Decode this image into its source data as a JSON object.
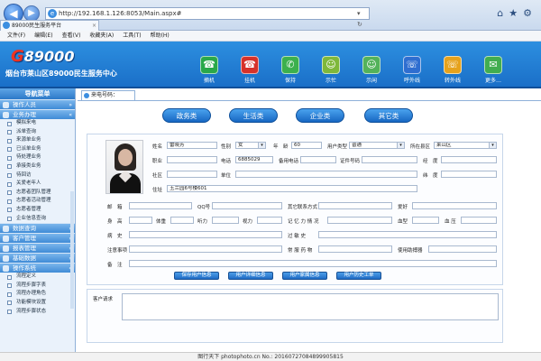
{
  "browser": {
    "url": "http://192.168.1.126:8053/Main.aspx#",
    "addr_ctrls": "▾ ↻ ✕",
    "tab_title": "89000民生服务平台",
    "tab_close": "×",
    "back": "◀",
    "forward": "▶"
  },
  "menubar": [
    "文件(F)",
    "编辑(E)",
    "查看(V)",
    "收藏夹(A)",
    "工具(T)",
    "帮助(H)"
  ],
  "header": {
    "logo": "89000",
    "logo_mark": "G",
    "title": "烟台市莱山区89000民生服务中心",
    "buttons": [
      {
        "label": "摘机",
        "color": "#2aa84a",
        "glyph": "☎"
      },
      {
        "label": "挂机",
        "color": "#d6322a",
        "glyph": "☎"
      },
      {
        "label": "保持",
        "color": "#3cb04d",
        "glyph": "✆"
      },
      {
        "label": "示忙",
        "color": "#7fb83a",
        "glyph": "☺"
      },
      {
        "label": "示闲",
        "color": "#53b25a",
        "glyph": "☺"
      },
      {
        "label": "呼外线",
        "color": "#2f6ed0",
        "glyph": "☏"
      },
      {
        "label": "转外线",
        "color": "#e6a21c",
        "glyph": "☏"
      },
      {
        "label": "更多…",
        "color": "#41ad4f",
        "glyph": "✉"
      }
    ]
  },
  "sidebar": {
    "title": "导航菜单",
    "groups_top": [
      {
        "label": "操作人员",
        "chev": "»"
      },
      {
        "label": "业务办理",
        "chev": "«"
      }
    ],
    "items": [
      "模拟来电",
      "派单查询",
      "来源单业务",
      "已派单业务",
      "待处理业务",
      "承接类业务",
      "待回访",
      "关爱老年人",
      "志愿者团队管理",
      "志愿者活动管理",
      "志愿者管理",
      "企业信息查询"
    ],
    "groups_bottom": [
      {
        "label": "数据查询",
        "chev": "»"
      },
      {
        "label": "客户管理",
        "chev": "»"
      },
      {
        "label": "报表管理",
        "chev": "»"
      },
      {
        "label": "基础数据",
        "chev": "»"
      },
      {
        "label": "操作系统",
        "chev": "«"
      }
    ],
    "items_bottom": [
      "流程定义",
      "流程步骤字表",
      "流程办理角色",
      "功能模块设置",
      "流程步骤状态"
    ]
  },
  "main": {
    "tab": "来电号码：",
    "categories": [
      "政务类",
      "生活类",
      "企业类",
      "其它类"
    ],
    "form": {
      "name_label": "姓名",
      "name": "雷晓芳",
      "gender_label": "性别",
      "gender": "女",
      "age_label": "年　龄",
      "age": "60",
      "usertype_label": "用户类型",
      "usertype": "普通",
      "region_label": "所在县区",
      "region": "莱山区",
      "job_label": "职业",
      "phone_label": "电话",
      "phone": "6885029",
      "backup_phone_label": "备用电话",
      "id_label": "证件号码",
      "lon_label": "经　度",
      "community_label": "社区",
      "unit_label": "单位",
      "lat_label": "纬　度",
      "address_label": "住址",
      "address": "玉兰园6号楼601",
      "email_label": "邮　箱",
      "qq_label": "QQ号",
      "other_contact_label": "其它联系方式",
      "hobby_label": "爱好",
      "height_label": "身　高",
      "weight_label": "体重",
      "hearing_label": "听力",
      "vision_label": "视力",
      "memory_label": "记 忆 力 情 况",
      "blood_label": "血型",
      "bp_label": "血 压",
      "history_label": "病　史",
      "allergy_label": "过 敏 史",
      "notes_label": "注意事项",
      "medicine_label": "常 服 药 物",
      "device_label": "使用助搏器",
      "remark_label": "备　注"
    },
    "actions": [
      "保存用户信息",
      "用户详细信息",
      "用户家属信息",
      "用户历史工单"
    ],
    "request_label": "客户请求"
  },
  "footer": "图行天下 photophoto.cn  No.: 20160727084899905815"
}
